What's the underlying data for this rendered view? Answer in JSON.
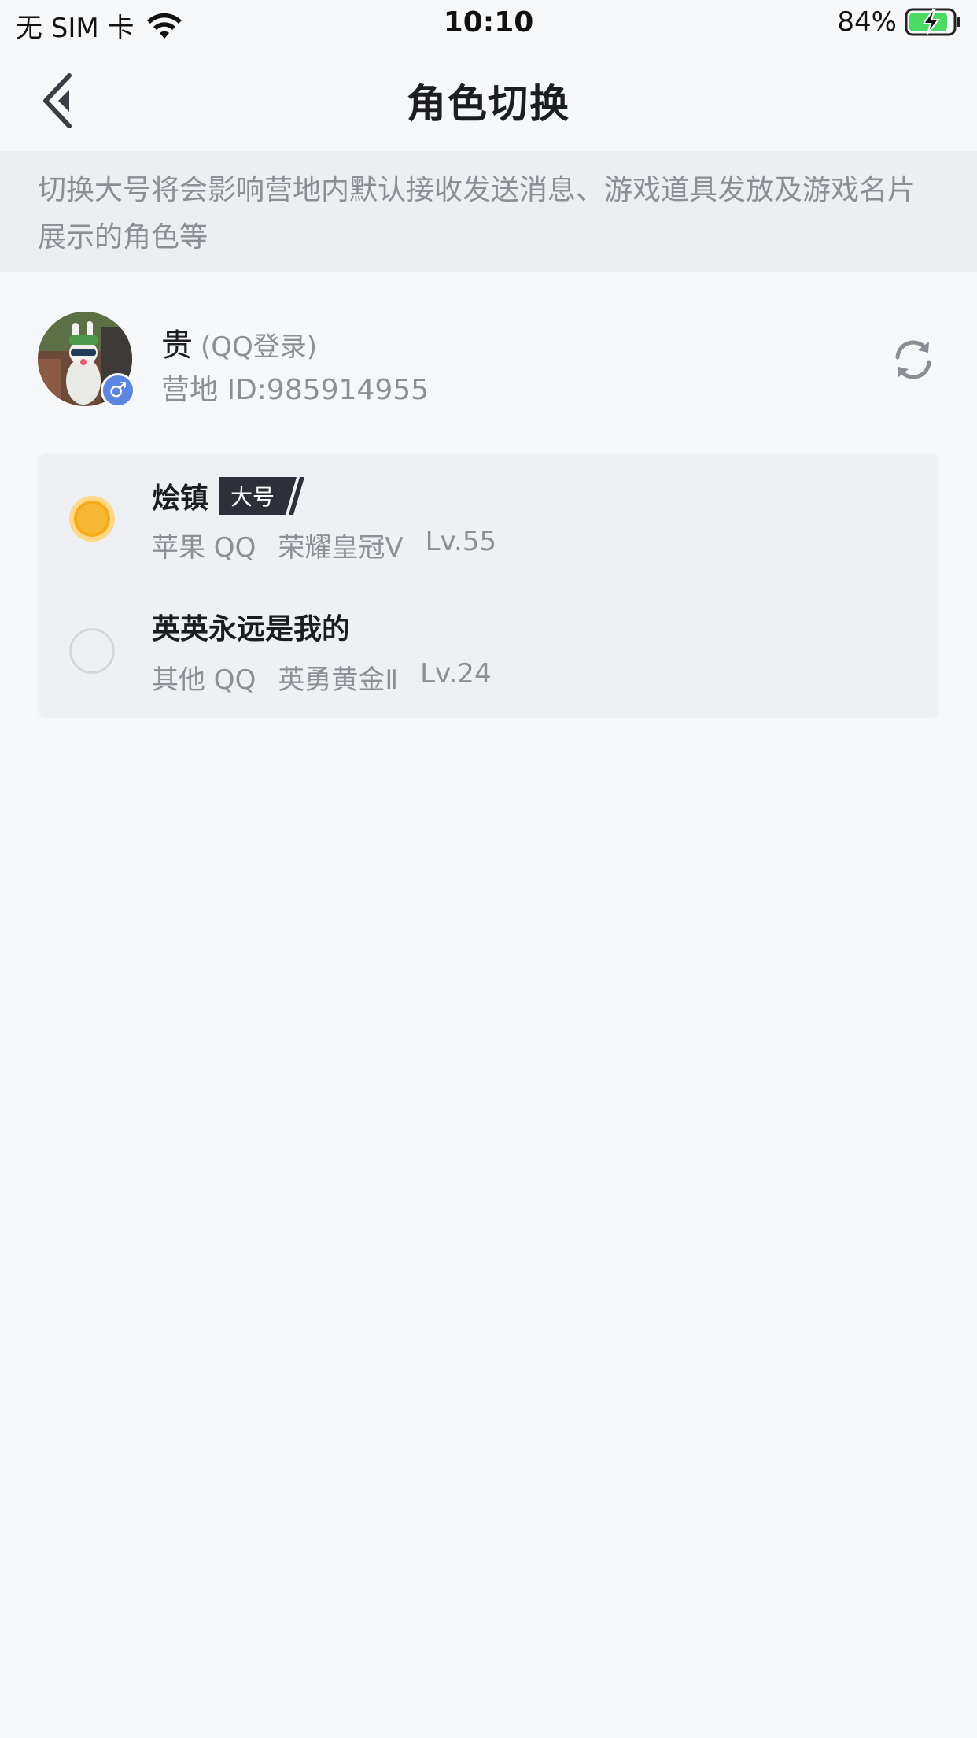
{
  "status_bar": {
    "carrier": "无 SIM 卡",
    "time": "10:10",
    "battery": "84%"
  },
  "nav": {
    "title": "角色切换"
  },
  "notice": {
    "text": "切换大号将会影响营地内默认接收发送消息、游戏道具发放及游戏名片展示的角色等"
  },
  "profile": {
    "name": "贵",
    "login_type": "(QQ登录)",
    "camp_id": "营地 ID:985914955",
    "gender_symbol": "♂"
  },
  "roles": [
    {
      "name": "烩镇",
      "tag": "大号",
      "platform": "苹果 QQ",
      "rank": "荣耀皇冠Ⅴ",
      "level": "Lv.55",
      "selected": true
    },
    {
      "name": "英英永远是我的",
      "tag": "",
      "platform": "其他 QQ",
      "rank": "英勇黄金Ⅱ",
      "level": "Lv.24",
      "selected": false
    }
  ],
  "colors": {
    "accent": "#f7b733",
    "tag_bg": "#2d3038",
    "gender_badge": "#5b86e0",
    "page_bg": "#f6f7f9"
  }
}
